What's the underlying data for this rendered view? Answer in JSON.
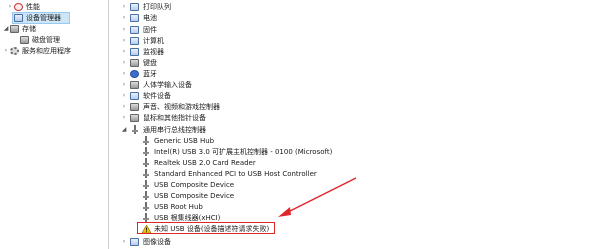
{
  "left_tree": {
    "items": [
      {
        "label": "性能"
      },
      {
        "label": "设备管理器"
      },
      {
        "label": "存储"
      },
      {
        "label": "磁盘管理"
      },
      {
        "label": "服务和应用程序"
      }
    ]
  },
  "device_tree": {
    "categories_top": [
      {
        "label": "打印队列"
      },
      {
        "label": "电池"
      },
      {
        "label": "固件"
      },
      {
        "label": "计算机"
      },
      {
        "label": "监视器"
      },
      {
        "label": "键盘"
      },
      {
        "label": "蓝牙"
      },
      {
        "label": "人体学输入设备"
      },
      {
        "label": "软件设备"
      },
      {
        "label": "声音、视频和游戏控制器"
      },
      {
        "label": "鼠标和其他指针设备"
      }
    ],
    "usb_category": {
      "label": "通用串行总线控制器"
    },
    "usb_children": [
      {
        "label": "Generic USB Hub"
      },
      {
        "label": "Intel(R) USB 3.0 可扩展主机控制器 - 0100 (Microsoft)"
      },
      {
        "label": "Realtek USB 2.0 Card Reader"
      },
      {
        "label": "Standard Enhanced PCI to USB Host Controller"
      },
      {
        "label": "USB Composite Device"
      },
      {
        "label": "USB Composite Device"
      },
      {
        "label": "USB Root Hub"
      },
      {
        "label": "USB 根集线器(xHCI)"
      },
      {
        "label": "未知 USB 设备(设备描述符请求失败)"
      }
    ],
    "last_category": {
      "label": "图像设备"
    }
  },
  "colors": {
    "highlight": "#e0262b",
    "selected": "#cde6f7"
  }
}
